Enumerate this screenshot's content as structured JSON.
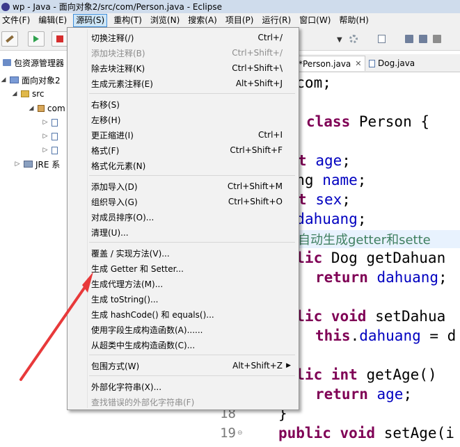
{
  "window": {
    "title": "wp - Java - 面向对象2/src/com/Person.java - Eclipse"
  },
  "menubar": {
    "items": [
      "文件(F)",
      "编辑(E)",
      "源码(S)",
      "重构(T)",
      "浏览(N)",
      "搜索(A)",
      "项目(P)",
      "运行(R)",
      "窗口(W)",
      "帮助(H)"
    ],
    "active_index": 2
  },
  "explorer": {
    "title": "包资源管理器",
    "project": "面向对象2",
    "src": "src",
    "package": "com",
    "jre": "JRE 系"
  },
  "editor": {
    "tabs": [
      {
        "label": "*Person.java",
        "active": true
      },
      {
        "label": "Dog.java",
        "active": false
      }
    ],
    "line_numbers": [
      "18",
      "19"
    ],
    "code_lines": [
      {
        "parts": [
          {
            "t": "e com;",
            "c": "plain"
          }
        ]
      },
      {
        "parts": [
          {
            "t": "class",
            "c": "kw"
          },
          {
            "t": " Person {",
            "c": "plain"
          }
        ]
      },
      {
        "parts": [
          {
            "t": "t",
            "c": "kw"
          },
          {
            "t": " ",
            "c": "plain"
          },
          {
            "t": "age",
            "c": "fld"
          },
          {
            "t": ";",
            "c": "plain"
          }
        ]
      },
      {
        "parts": [
          {
            "t": "ring ",
            "c": "plain"
          },
          {
            "t": "name",
            "c": "fld"
          },
          {
            "t": ";",
            "c": "plain"
          }
        ]
      },
      {
        "parts": [
          {
            "t": "t",
            "c": "kw"
          },
          {
            "t": " ",
            "c": "plain"
          },
          {
            "t": "sex",
            "c": "fld"
          },
          {
            "t": ";",
            "c": "plain"
          }
        ]
      },
      {
        "parts": [
          {
            "t": "g ",
            "c": "plain"
          },
          {
            "t": "dahuang",
            "c": "fld"
          },
          {
            "t": ";",
            "c": "plain"
          }
        ]
      },
      {
        "parts": [
          {
            "t": "自动生成getter和sette",
            "c": "cmt"
          }
        ]
      },
      {
        "parts": [
          {
            "t": "ublic",
            "c": "kw"
          },
          {
            "t": " Dog getDahuan",
            "c": "plain"
          }
        ]
      },
      {
        "parts": [
          {
            "t": "return",
            "c": "kw"
          },
          {
            "t": " ",
            "c": "plain"
          },
          {
            "t": "dahuang",
            "c": "fld"
          },
          {
            "t": ";",
            "c": "plain"
          }
        ]
      },
      {
        "parts": [
          {
            "t": "ublic void",
            "c": "kw"
          },
          {
            "t": " setDahua",
            "c": "plain"
          }
        ]
      },
      {
        "parts": [
          {
            "t": "this",
            "c": "kw"
          },
          {
            "t": ".",
            "c": "plain"
          },
          {
            "t": "dahuang",
            "c": "fld"
          },
          {
            "t": " = d",
            "c": "plain"
          }
        ]
      },
      {
        "parts": [
          {
            "t": "ublic int",
            "c": "kw"
          },
          {
            "t": " getAge()",
            "c": "plain"
          }
        ]
      },
      {
        "parts": [
          {
            "t": "return",
            "c": "kw"
          },
          {
            "t": " ",
            "c": "plain"
          },
          {
            "t": "age",
            "c": "fld"
          },
          {
            "t": ";",
            "c": "plain"
          }
        ]
      },
      {
        "parts": [
          {
            "t": "}",
            "c": "plain"
          }
        ]
      },
      {
        "parts": [
          {
            "t": "public void",
            "c": "kw"
          },
          {
            "t": " setAge(i",
            "c": "plain"
          }
        ]
      }
    ]
  },
  "source_menu": {
    "groups": [
      [
        {
          "label": "切换注释(/)",
          "shortcut": "Ctrl+/",
          "enabled": true
        },
        {
          "label": "添加块注释(B)",
          "shortcut": "Ctrl+Shift+/",
          "enabled": false
        },
        {
          "label": "除去块注释(K)",
          "shortcut": "Ctrl+Shift+\\",
          "enabled": true
        },
        {
          "label": "生成元素注释(E)",
          "shortcut": "Alt+Shift+J",
          "enabled": true
        }
      ],
      [
        {
          "label": "右移(S)",
          "shortcut": "",
          "enabled": true
        },
        {
          "label": "左移(H)",
          "shortcut": "",
          "enabled": true
        },
        {
          "label": "更正缩进(I)",
          "shortcut": "Ctrl+I",
          "enabled": true
        },
        {
          "label": "格式(F)",
          "shortcut": "Ctrl+Shift+F",
          "enabled": true
        },
        {
          "label": "格式化元素(N)",
          "shortcut": "",
          "enabled": true
        }
      ],
      [
        {
          "label": "添加导入(D)",
          "shortcut": "Ctrl+Shift+M",
          "enabled": true
        },
        {
          "label": "组织导入(G)",
          "shortcut": "Ctrl+Shift+O",
          "enabled": true
        },
        {
          "label": "对成员排序(O)...",
          "shortcut": "",
          "enabled": true
        },
        {
          "label": "清理(U)...",
          "shortcut": "",
          "enabled": true
        }
      ],
      [
        {
          "label": "覆盖 / 实现方法(V)...",
          "shortcut": "",
          "enabled": true
        },
        {
          "label": "生成 Getter 和 Setter...",
          "shortcut": "",
          "enabled": true
        },
        {
          "label": "生成代理方法(M)...",
          "shortcut": "",
          "enabled": true
        },
        {
          "label": "生成 toString()...",
          "shortcut": "",
          "enabled": true
        },
        {
          "label": "生成 hashCode() 和 equals()...",
          "shortcut": "",
          "enabled": true
        },
        {
          "label": "使用字段生成构造函数(A)......",
          "shortcut": "",
          "enabled": true
        },
        {
          "label": "从超类中生成构造函数(C)...",
          "shortcut": "",
          "enabled": true
        }
      ],
      [
        {
          "label": "包围方式(W)",
          "shortcut": "Alt+Shift+Z",
          "enabled": true,
          "submenu": true
        }
      ],
      [
        {
          "label": "外部化字符串(X)...",
          "shortcut": "",
          "enabled": true
        },
        {
          "label": "查找错误的外部化字符串(F)",
          "shortcut": "",
          "enabled": false
        }
      ]
    ]
  },
  "annotation": {
    "arrow_color": "#e8393a"
  }
}
